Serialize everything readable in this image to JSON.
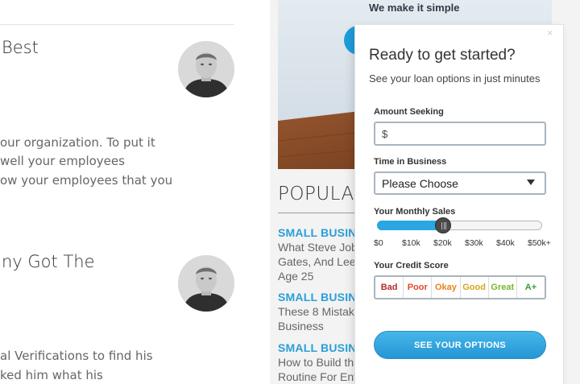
{
  "articles": [
    {
      "title_fragment": "Best",
      "lines": [
        "our organization. To put it",
        "well your employees",
        "ow your employees that you"
      ]
    },
    {
      "title_fragment": "ny Got The",
      "lines": [
        "al Verifications to find his",
        "ked him what his"
      ]
    }
  ],
  "hero": {
    "headline": "We make it simple"
  },
  "popular": {
    "title": "POPULA",
    "items": [
      {
        "category": "SMALL BUSIN",
        "lines": [
          "What Steve Job",
          "Gates, And Lee",
          "Age 25"
        ]
      },
      {
        "category": "SMALL BUSIN",
        "lines": [
          "These 8 Mistak",
          "Business"
        ]
      },
      {
        "category": "SMALL BUSIN",
        "lines": [
          "How to Build th",
          "Routine For Ent"
        ]
      }
    ]
  },
  "form": {
    "close_symbol": "×",
    "title": "Ready to get started?",
    "subtitle": "See your loan options in just minutes",
    "amount": {
      "label": "Amount Seeking",
      "placeholder": "$"
    },
    "time_in_business": {
      "label": "Time in Business",
      "selected": "Please Choose"
    },
    "monthly_sales": {
      "label": "Your Monthly Sales",
      "ticks": [
        "$0",
        "$10k",
        "$20k",
        "$30k",
        "$40k",
        "$50k+"
      ],
      "value": "$20k"
    },
    "credit_score": {
      "label": "Your Credit Score",
      "options": [
        {
          "label": "Bad",
          "color": "#b52a2a"
        },
        {
          "label": "Poor",
          "color": "#e0472f"
        },
        {
          "label": "Okay",
          "color": "#e8831e"
        },
        {
          "label": "Good",
          "color": "#d9a51a"
        },
        {
          "label": "Great",
          "color": "#7ab62b"
        },
        {
          "label": "A+",
          "color": "#3d9a3a"
        }
      ]
    },
    "cta_label": "SEE YOUR OPTIONS"
  },
  "colors": {
    "accent": "#2aa6e2",
    "link": "#2a9fd8"
  },
  "icons": [
    "close-icon",
    "chevron-down-icon",
    "slider-grip-icon",
    "avatar-photo"
  ]
}
